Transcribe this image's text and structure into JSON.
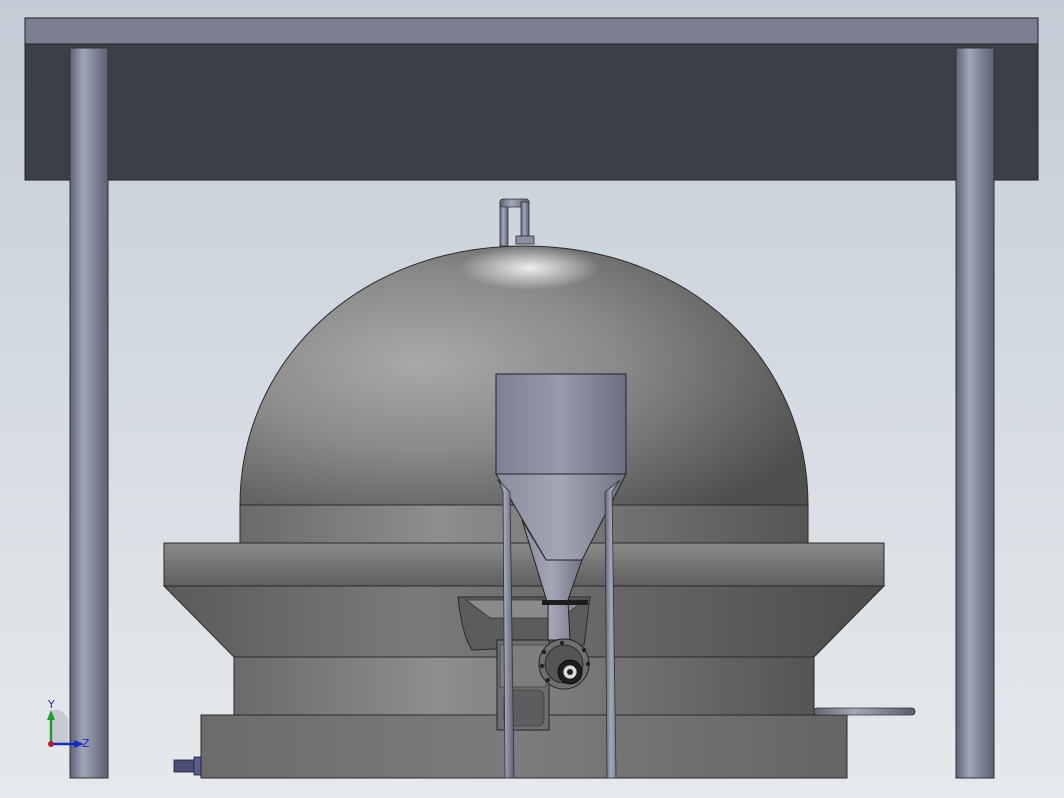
{
  "viewport": {
    "background_top": "#c3ccd6",
    "background_bottom": "#e6e9ec"
  },
  "model": {
    "colors": {
      "beam_face": "#3c3f48",
      "beam_top": "#7c7f91",
      "column": "#8a8fa3",
      "shell": "#8a8a8a",
      "hopper": "#7e8194",
      "base": "#707070"
    }
  },
  "triad": {
    "y_label": "Y",
    "z_label": "Z",
    "y_color": "#1e9d2b",
    "z_color": "#1b2bbf",
    "origin_color": "#c0172a"
  }
}
